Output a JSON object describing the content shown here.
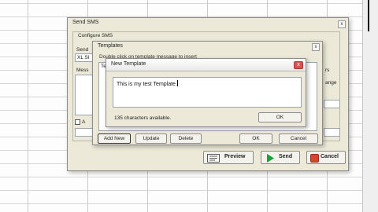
{
  "send_sms": {
    "title": "Send SMS",
    "close": "x",
    "configure_label": "Configure SMS",
    "send_from_label": "Send",
    "send_from_value": "XL SI",
    "message_label": "Mess",
    "right_label_1": "rs",
    "right_label_2": "ange",
    "a_label": "A",
    "buttons": {
      "preview": "Preview",
      "send": "Send",
      "cancel": "Cancel"
    }
  },
  "templates": {
    "title": "Templates",
    "close": "x",
    "instruction": "Double click on template message to insert",
    "column_header_stub": "Te",
    "buttons": {
      "add_new": "Add New",
      "update": "Update",
      "delete": "Delete",
      "ok": "OK",
      "cancel": "Cancel"
    }
  },
  "new_template": {
    "title": "New Template",
    "close": "x",
    "text_value": "This is my test Template.",
    "chars_available": "135 characters available.",
    "ok": "OK"
  },
  "colors": {
    "send_green": "#1f9d3a",
    "cancel_red": "#d9442e",
    "close_red": "#d9534f"
  }
}
